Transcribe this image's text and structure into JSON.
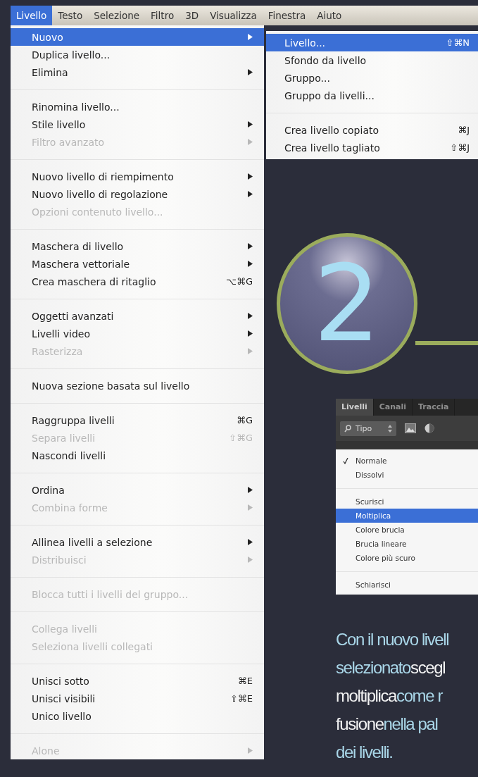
{
  "menu_bar": [
    {
      "label": "Livello",
      "selected": true
    },
    {
      "label": "Testo",
      "selected": false
    },
    {
      "label": "Selezione",
      "selected": false
    },
    {
      "label": "Filtro",
      "selected": false
    },
    {
      "label": "3D",
      "selected": false
    },
    {
      "label": "Visualizza",
      "selected": false
    },
    {
      "label": "Finestra",
      "selected": false
    },
    {
      "label": "Aiuto",
      "selected": false
    }
  ],
  "menu": {
    "groups": [
      [
        {
          "label": "Nuovo",
          "submenu": true,
          "disabled": false,
          "selected": true
        },
        {
          "label": "Duplica livello...",
          "submenu": false,
          "disabled": false,
          "selected": false
        },
        {
          "label": "Elimina",
          "submenu": true,
          "disabled": false,
          "selected": false
        }
      ],
      [
        {
          "label": "Rinomina livello...",
          "submenu": false,
          "disabled": false,
          "selected": false
        },
        {
          "label": "Stile livello",
          "submenu": true,
          "disabled": false,
          "selected": false
        },
        {
          "label": "Filtro avanzato",
          "submenu": true,
          "disabled": true,
          "selected": false
        }
      ],
      [
        {
          "label": "Nuovo livello di riempimento",
          "submenu": true,
          "disabled": false,
          "selected": false
        },
        {
          "label": "Nuovo livello di regolazione",
          "submenu": true,
          "disabled": false,
          "selected": false
        },
        {
          "label": "Opzioni contenuto livello...",
          "submenu": false,
          "disabled": true,
          "selected": false
        }
      ],
      [
        {
          "label": "Maschera di livello",
          "submenu": true,
          "disabled": false,
          "selected": false
        },
        {
          "label": "Maschera vettoriale",
          "submenu": true,
          "disabled": false,
          "selected": false
        },
        {
          "label": "Crea maschera di ritaglio",
          "shortcut": "⌥⌘G",
          "submenu": false,
          "disabled": false,
          "selected": false
        }
      ],
      [
        {
          "label": "Oggetti avanzati",
          "submenu": true,
          "disabled": false,
          "selected": false
        },
        {
          "label": "Livelli video",
          "submenu": true,
          "disabled": false,
          "selected": false
        },
        {
          "label": "Rasterizza",
          "submenu": true,
          "disabled": true,
          "selected": false
        }
      ],
      [
        {
          "label": "Nuova sezione basata sul livello",
          "submenu": false,
          "disabled": false,
          "selected": false
        }
      ],
      [
        {
          "label": "Raggruppa livelli",
          "shortcut": "⌘G",
          "submenu": false,
          "disabled": false,
          "selected": false
        },
        {
          "label": "Separa livelli",
          "shortcut": "⇧⌘G",
          "submenu": false,
          "disabled": true,
          "selected": false
        },
        {
          "label": "Nascondi livelli",
          "submenu": false,
          "disabled": false,
          "selected": false
        }
      ],
      [
        {
          "label": "Ordina",
          "submenu": true,
          "disabled": false,
          "selected": false
        },
        {
          "label": "Combina forme",
          "submenu": true,
          "disabled": true,
          "selected": false
        }
      ],
      [
        {
          "label": "Allinea livelli a selezione",
          "submenu": true,
          "disabled": false,
          "selected": false
        },
        {
          "label": "Distribuisci",
          "submenu": true,
          "disabled": true,
          "selected": false
        }
      ],
      [
        {
          "label": "Blocca tutti i livelli del gruppo...",
          "submenu": false,
          "disabled": true,
          "selected": false
        }
      ],
      [
        {
          "label": "Collega livelli",
          "submenu": false,
          "disabled": true,
          "selected": false
        },
        {
          "label": "Seleziona livelli collegati",
          "submenu": false,
          "disabled": true,
          "selected": false
        }
      ],
      [
        {
          "label": "Unisci sotto",
          "shortcut": "⌘E",
          "submenu": false,
          "disabled": false,
          "selected": false
        },
        {
          "label": "Unisci visibili",
          "shortcut": "⇧⌘E",
          "submenu": false,
          "disabled": false,
          "selected": false
        },
        {
          "label": "Unico livello",
          "submenu": false,
          "disabled": false,
          "selected": false
        }
      ],
      [
        {
          "label": "Alone",
          "submenu": true,
          "disabled": true,
          "selected": false
        }
      ]
    ]
  },
  "submenu": {
    "groups": [
      [
        {
          "label": "Livello...",
          "shortcut": "⇧⌘N",
          "submenu": false,
          "disabled": false,
          "selected": true
        },
        {
          "label": "Sfondo da livello",
          "submenu": false,
          "disabled": false,
          "selected": false
        },
        {
          "label": "Gruppo...",
          "submenu": false,
          "disabled": false,
          "selected": false
        },
        {
          "label": "Gruppo da livelli...",
          "submenu": false,
          "disabled": false,
          "selected": false
        }
      ],
      [
        {
          "label": "Crea livello copiato",
          "shortcut": "⌘J",
          "submenu": false,
          "disabled": false,
          "selected": false
        },
        {
          "label": "Crea livello tagliato",
          "shortcut": "⇧⌘J",
          "submenu": false,
          "disabled": false,
          "selected": false
        }
      ]
    ]
  },
  "step_badge": {
    "number": "2"
  },
  "layers_panel": {
    "tabs": [
      {
        "label": "Livelli",
        "selected": true
      },
      {
        "label": "Canali",
        "selected": false
      },
      {
        "label": "Traccia",
        "selected": false
      }
    ],
    "filter_field": {
      "value": "Tipo"
    },
    "blend_modes": {
      "groups": [
        [
          {
            "label": "Normale",
            "checked": true,
            "selected": false
          },
          {
            "label": "Dissolvi",
            "checked": false,
            "selected": false
          }
        ],
        [
          {
            "label": "Scurisci",
            "checked": false,
            "selected": false
          },
          {
            "label": "Moltiplica",
            "checked": false,
            "selected": true
          },
          {
            "label": "Colore brucia",
            "checked": false,
            "selected": false
          },
          {
            "label": "Brucia lineare",
            "checked": false,
            "selected": false
          },
          {
            "label": "Colore più scuro",
            "checked": false,
            "selected": false
          }
        ],
        [
          {
            "label": "Schiarisci",
            "checked": false,
            "selected": false
          }
        ]
      ]
    }
  },
  "caption": {
    "lines": [
      [
        {
          "text": "Con il nuovo livell",
          "highlight": true
        }
      ],
      [
        {
          "text": "selezionato",
          "highlight": true
        },
        {
          "text": "scegl",
          "highlight": false
        }
      ],
      [
        {
          "text": "moltiplica",
          "highlight": false
        },
        {
          "text": "come r",
          "highlight": true
        }
      ],
      [
        {
          "text": "fusione",
          "highlight": false
        },
        {
          "text": "nella pal",
          "highlight": true
        }
      ],
      [
        {
          "text": "dei livelli.",
          "highlight": true
        }
      ]
    ]
  }
}
